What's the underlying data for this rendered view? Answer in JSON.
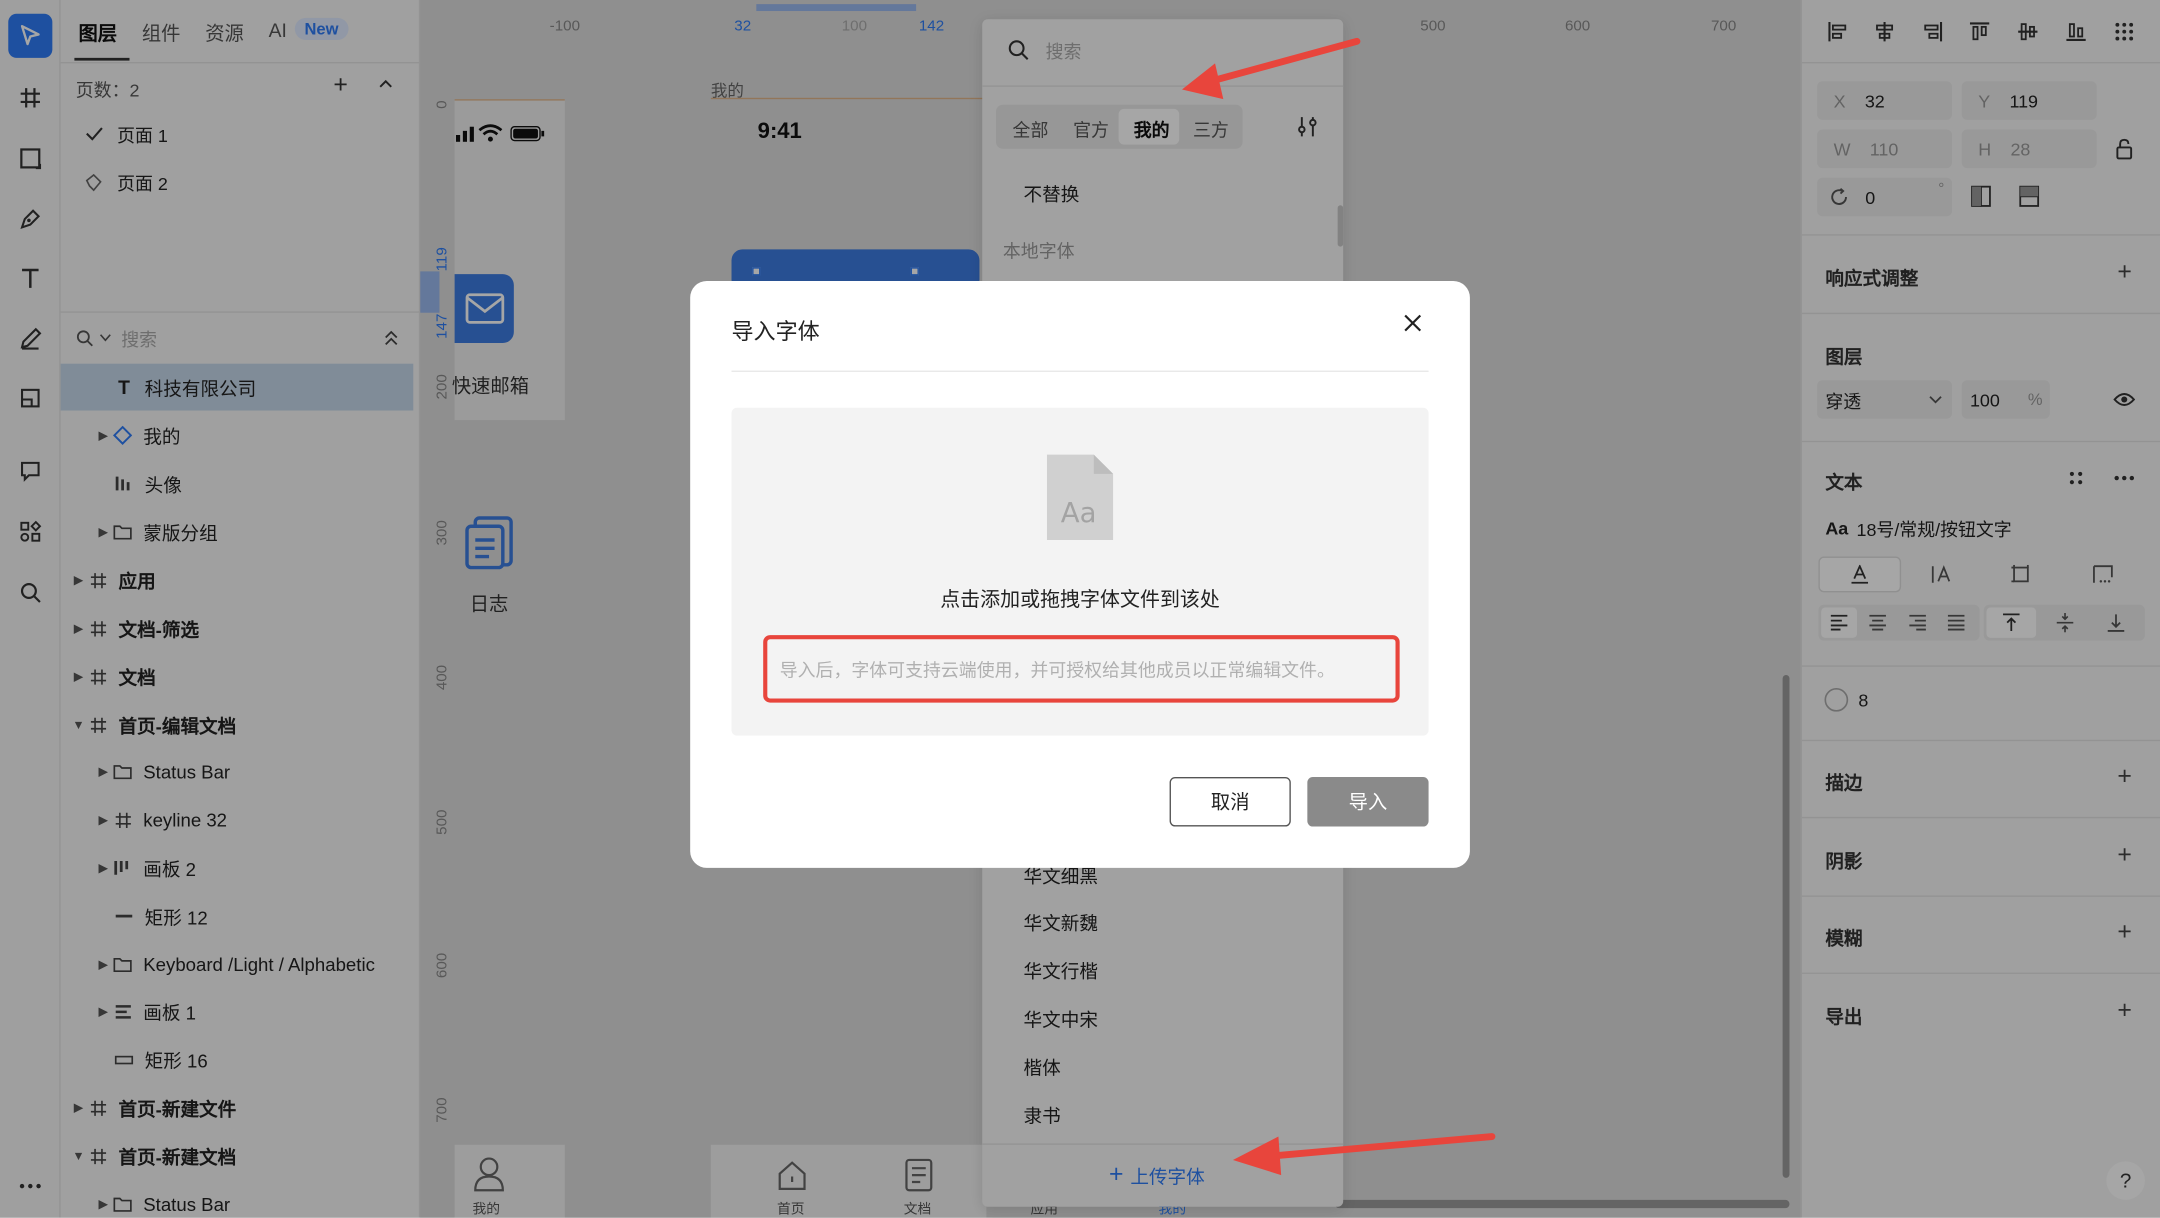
{
  "left_panel": {
    "tabs": [
      "图层",
      "组件",
      "资源",
      "AI"
    ],
    "ai_badge": "New",
    "page_count": "页数：2",
    "pages": [
      "页面 1",
      "页面 2"
    ],
    "search_placeholder": "搜索",
    "layers": [
      {
        "label": "科技有限公司"
      },
      {
        "label": "我的"
      },
      {
        "label": "头像"
      },
      {
        "label": "蒙版分组"
      },
      {
        "label": "应用"
      },
      {
        "label": "文档-筛选"
      },
      {
        "label": "文档"
      },
      {
        "label": "首页-编辑文档"
      },
      {
        "label": "Status Bar"
      },
      {
        "label": "keyline 32"
      },
      {
        "label": "画板 2"
      },
      {
        "label": "矩形 12"
      },
      {
        "label": "Keyboard /Light / Alphabetic"
      },
      {
        "label": "画板 1"
      },
      {
        "label": "矩形 16"
      },
      {
        "label": "首页-新建文件"
      },
      {
        "label": "首页-新建文档"
      },
      {
        "label": "Status Bar"
      }
    ]
  },
  "canvas": {
    "ruler_top": [
      "-100",
      "32",
      "100",
      "142",
      "500",
      "600",
      "700"
    ],
    "ruler_left": [
      "0",
      "119",
      "147",
      "200",
      "300",
      "400",
      "500",
      "600",
      "700"
    ],
    "artboard_labels": [
      "我的"
    ],
    "phone_time": "9:41",
    "app_icons": [
      "快速邮箱",
      "日志"
    ],
    "tabbar": [
      "我的",
      "首页",
      "文档",
      "应用",
      "我的"
    ]
  },
  "font_panel": {
    "search_placeholder": "搜索",
    "filters": [
      "全部",
      "官方",
      "我的",
      "三方"
    ],
    "no_replace": "不替换",
    "local_fonts_heading": "本地字体",
    "fonts": [
      "华文细黑",
      "华文新魏",
      "华文行楷",
      "华文中宋",
      "楷体",
      "隶书"
    ],
    "upload_label": "上传字体"
  },
  "dialog": {
    "title": "导入字体",
    "file_glyph": "Aa",
    "drop_text": "点击添加或拖拽字体文件到该处",
    "notice": "导入后，字体可支持云端使用，并可授权给其他成员以正常编辑文件。",
    "cancel_label": "取消",
    "import_label": "导入"
  },
  "right_panel": {
    "x_label": "X",
    "x_value": "32",
    "y_label": "Y",
    "y_value": "119",
    "w_label": "W",
    "w_value": "110",
    "h_label": "H",
    "h_value": "28",
    "rotation_value": "0",
    "rotation_unit": "°",
    "responsive": "响应式调整",
    "layer": "图层",
    "blend_mode": "穿透",
    "opacity": "100",
    "opacity_unit": "%",
    "text": "文本",
    "text_style_prefix": "Aa",
    "text_style": "18号/常规/按钮文字",
    "radius_value": "8",
    "stroke": "描边",
    "shadow": "阴影",
    "blur": "模糊",
    "export": "导出",
    "help": "?"
  },
  "colors": {
    "accent": "#2f7cf6",
    "annotation_red": "#e8453c",
    "import_button": "#8a8a8a"
  }
}
